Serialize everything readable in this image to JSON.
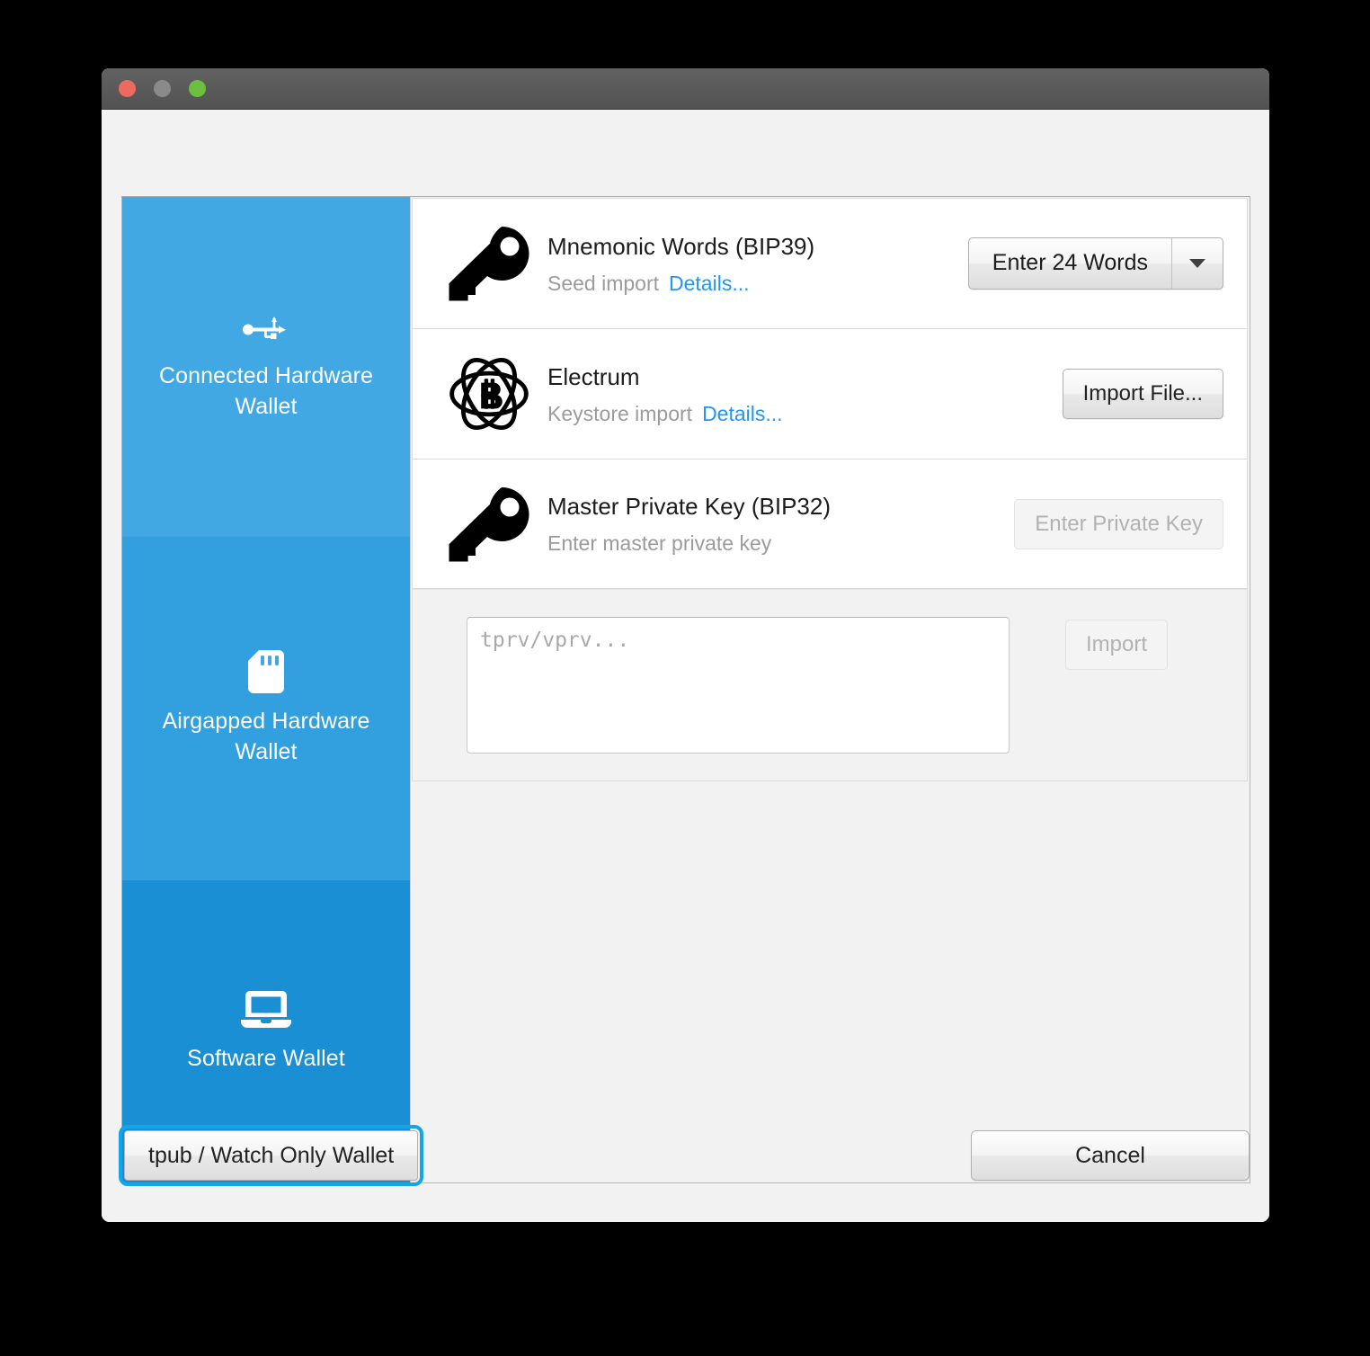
{
  "window": {
    "traffic_lights": [
      "close",
      "minimize",
      "maximize"
    ],
    "colors": {
      "titlebar": "#585858",
      "close": "#ec6a5e",
      "minimize": "#8a8a8a",
      "maximize": "#6cbf3f",
      "accent_blue": "#2196f3",
      "sidebar_blue": "#41a8e4",
      "sidebar_blue_mid": "#329fdf",
      "sidebar_blue_selected": "#1b8fd4",
      "focus_ring": "#12a5e8"
    }
  },
  "sidebar": {
    "items": [
      {
        "label": "Connected Hardware Wallet",
        "icon": "usb-icon",
        "selected": false
      },
      {
        "label": "Airgapped Hardware Wallet",
        "icon": "sdcard-icon",
        "selected": false
      },
      {
        "label": "Software Wallet",
        "icon": "laptop-icon",
        "selected": true
      }
    ]
  },
  "main": {
    "rows": [
      {
        "icon": "key-icon",
        "title": "Mnemonic Words (BIP39)",
        "subtitle": "Seed import",
        "details_label": "Details...",
        "action_type": "split-button",
        "action_label": "Enter 24 Words",
        "action_disabled": false
      },
      {
        "icon": "electrum-icon",
        "title": "Electrum",
        "subtitle": "Keystore import",
        "details_label": "Details...",
        "action_type": "button",
        "action_label": "Import File...",
        "action_disabled": false
      },
      {
        "icon": "key-icon",
        "title": "Master Private Key (BIP32)",
        "subtitle": "Enter master private key",
        "details_label": "",
        "action_type": "button",
        "action_label": "Enter Private Key",
        "action_disabled": true
      }
    ],
    "private_key_panel": {
      "textarea_value": "",
      "textarea_placeholder": "tprv/vprv...",
      "import_label": "Import",
      "import_disabled": true
    }
  },
  "footer": {
    "watch_only_label": "tpub / Watch Only Wallet",
    "cancel_label": "Cancel"
  }
}
